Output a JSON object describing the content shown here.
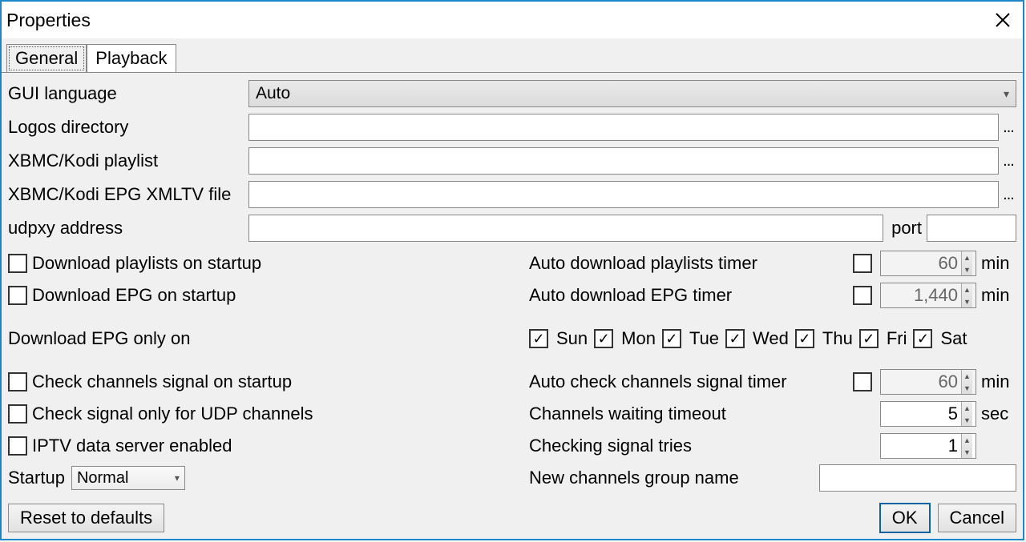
{
  "window": {
    "title": "Properties"
  },
  "tabs": {
    "general": "General",
    "playback": "Playback"
  },
  "labels": {
    "gui_language": "GUI language",
    "logos_dir": "Logos directory",
    "kodi_playlist": "XBMC/Kodi playlist",
    "kodi_epg": "XBMC/Kodi EPG XMLTV file",
    "udpxy": "udpxy address",
    "port": "port",
    "dl_playlists": "Download playlists on startup",
    "dl_epg": "Download EPG on startup",
    "dl_epg_only_on": "Download EPG only on",
    "auto_dl_playlists_timer": "Auto download playlists timer",
    "auto_dl_epg_timer": "Auto download EPG timer",
    "check_signal_startup": "Check channels signal on startup",
    "check_signal_udp": "Check signal only for UDP channels",
    "iptv_server": "IPTV data server enabled",
    "auto_check_signal_timer": "Auto check channels signal timer",
    "channels_wait_timeout": "Channels waiting timeout",
    "checking_tries": "Checking signal tries",
    "new_group": "New channels group name",
    "startup": "Startup"
  },
  "values": {
    "gui_language": "Auto",
    "logos_dir": "",
    "kodi_playlist": "",
    "kodi_epg": "",
    "udpxy": "",
    "port": "",
    "playlist_timer": "60",
    "epg_timer": "1,440",
    "signal_timer": "60",
    "wait_timeout": "5",
    "tries": "1",
    "new_group": "",
    "startup": "Normal"
  },
  "checks": {
    "dl_playlists": false,
    "dl_epg": false,
    "auto_dl_playlists": false,
    "auto_dl_epg": false,
    "check_signal": false,
    "check_udp_only": false,
    "iptv_server": false,
    "auto_check_signal": false
  },
  "units": {
    "min": "min",
    "sec": "sec"
  },
  "days": {
    "sun": "Sun",
    "mon": "Mon",
    "tue": "Tue",
    "wed": "Wed",
    "thu": "Thu",
    "fri": "Fri",
    "sat": "Sat"
  },
  "day_checks": {
    "sun": true,
    "mon": true,
    "tue": true,
    "wed": true,
    "thu": true,
    "fri": true,
    "sat": true
  },
  "buttons": {
    "reset": "Reset to defaults",
    "ok": "OK",
    "cancel": "Cancel",
    "browse": "..."
  }
}
